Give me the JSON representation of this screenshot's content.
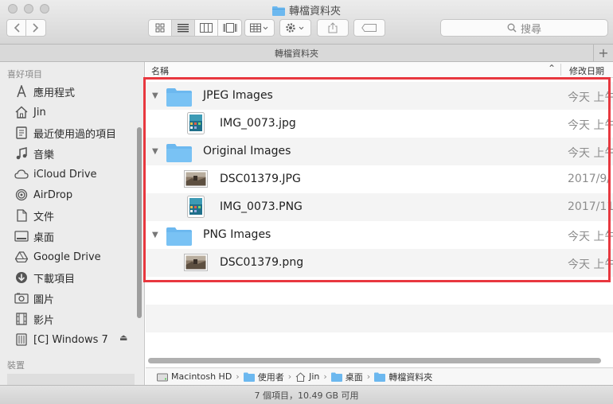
{
  "window": {
    "title": "轉檔資料夾",
    "tab_title": "轉檔資料夾",
    "tab_add": "+",
    "search_placeholder": "搜尋"
  },
  "sidebar": {
    "favorites_heading": "喜好項目",
    "items": [
      {
        "label": "應用程式",
        "icon": "applications-icon"
      },
      {
        "label": "Jin",
        "icon": "home-icon"
      },
      {
        "label": "最近使用過的項目",
        "icon": "recents-icon"
      },
      {
        "label": "音樂",
        "icon": "music-icon"
      },
      {
        "label": "iCloud Drive",
        "icon": "cloud-icon"
      },
      {
        "label": "AirDrop",
        "icon": "airdrop-icon"
      },
      {
        "label": "文件",
        "icon": "documents-icon"
      },
      {
        "label": "桌面",
        "icon": "desktop-icon"
      },
      {
        "label": "Google Drive",
        "icon": "google-drive-icon"
      },
      {
        "label": "下載項目",
        "icon": "downloads-icon"
      },
      {
        "label": "圖片",
        "icon": "pictures-icon"
      },
      {
        "label": "影片",
        "icon": "movies-icon"
      },
      {
        "label": "[C] Windows 7",
        "icon": "disk-icon"
      }
    ],
    "eject_symbol": "⏏",
    "devices_heading": "裝置"
  },
  "columns": {
    "name": "名稱",
    "date": "修改日期"
  },
  "rows": [
    {
      "name": "JPEG Images",
      "kind": "folder",
      "level": 0,
      "date": "今天 上午"
    },
    {
      "name": "IMG_0073.jpg",
      "kind": "ipad",
      "level": 1,
      "date": "今天 上午"
    },
    {
      "name": "Original Images",
      "kind": "folder",
      "level": 0,
      "date": "今天 上午"
    },
    {
      "name": "DSC01379.JPG",
      "kind": "photo",
      "level": 1,
      "date": "2017/9/"
    },
    {
      "name": "IMG_0073.PNG",
      "kind": "ipad",
      "level": 1,
      "date": "2017/11"
    },
    {
      "name": "PNG Images",
      "kind": "folder",
      "level": 0,
      "date": "今天 上午"
    },
    {
      "name": "DSC01379.png",
      "kind": "photo",
      "level": 1,
      "date": "今天 上午"
    }
  ],
  "path": [
    {
      "label": "Macintosh HD",
      "icon": "hard-drive-icon"
    },
    {
      "label": "使用者",
      "icon": "folder-icon"
    },
    {
      "label": "Jin",
      "icon": "home-icon"
    },
    {
      "label": "桌面",
      "icon": "folder-icon"
    },
    {
      "label": "轉檔資料夾",
      "icon": "folder-icon"
    }
  ],
  "status": "7 個項目，10.49 GB 可用",
  "colors": {
    "highlight": "#e8383f",
    "folder": "#6cb8ef"
  }
}
